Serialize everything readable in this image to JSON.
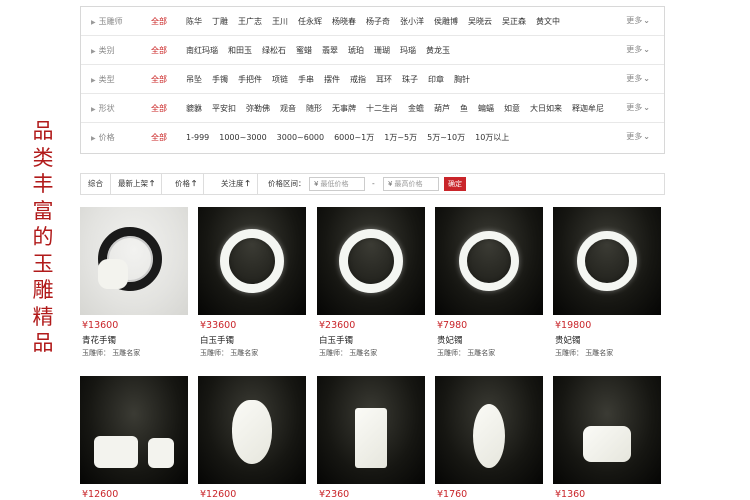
{
  "side_title": [
    "品",
    "类",
    "丰",
    "富",
    "的",
    "玉",
    "雕",
    "精",
    "品"
  ],
  "filters": [
    {
      "label": "玉雕师",
      "all": "全部",
      "options": [
        "陈华",
        "丁雕",
        "王广志",
        "王川",
        "任永辉",
        "杨晓春",
        "杨子奇",
        "张小洋",
        "侯雕博",
        "吴晓云",
        "吴正森",
        "黄文中"
      ],
      "more": "更多"
    },
    {
      "label": "类别",
      "all": "全部",
      "options": [
        "南红玛瑙",
        "和田玉",
        "绿松石",
        "蜜蜡",
        "翡翠",
        "琥珀",
        "珊瑚",
        "玛瑙",
        "黄龙玉"
      ],
      "more": "更多"
    },
    {
      "label": "类型",
      "all": "全部",
      "options": [
        "吊坠",
        "手镯",
        "手把件",
        "项链",
        "手串",
        "摆件",
        "戒指",
        "耳环",
        "珠子",
        "印章",
        "胸针"
      ],
      "more": "更多"
    },
    {
      "label": "形状",
      "all": "全部",
      "options": [
        "貔貅",
        "平安扣",
        "弥勒佛",
        "观音",
        "随形",
        "无事牌",
        "十二生肖",
        "金蟾",
        "葫芦",
        "鱼",
        "蝙蝠",
        "如意",
        "大日如来",
        "释迦牟尼"
      ],
      "more": "更多"
    },
    {
      "label": "价格",
      "all": "全部",
      "options": [
        "1-999",
        "1000~3000",
        "3000~6000",
        "6000~1万",
        "1万~5万",
        "5万~10万",
        "10万以上"
      ],
      "more": "更多"
    }
  ],
  "sortbar": {
    "overall": "综合",
    "newest": "最新上架",
    "price": "价格",
    "attention": "关注度",
    "range_label": "价格区间：",
    "min_placeholder": "最低价格",
    "max_placeholder": "最高价格",
    "currency": "¥",
    "dash": "-",
    "confirm": "确定"
  },
  "products_row1": [
    {
      "price": "¥13600",
      "name": "青花手镯",
      "carver": "玉雕师：  玉雕名家"
    },
    {
      "price": "¥33600",
      "name": "白玉手镯",
      "carver": "玉雕师：  玉雕名家"
    },
    {
      "price": "¥23600",
      "name": "白玉手镯",
      "carver": "玉雕师：  玉雕名家"
    },
    {
      "price": "¥7980",
      "name": "贵妃镯",
      "carver": "玉雕师：  玉雕名家"
    },
    {
      "price": "¥19800",
      "name": "贵妃镯",
      "carver": "玉雕师：  玉雕名家"
    }
  ],
  "products_row2": [
    {
      "price": "¥12600"
    },
    {
      "price": "¥12600"
    },
    {
      "price": "¥2360"
    },
    {
      "price": "¥1760"
    },
    {
      "price": "¥1360"
    }
  ]
}
